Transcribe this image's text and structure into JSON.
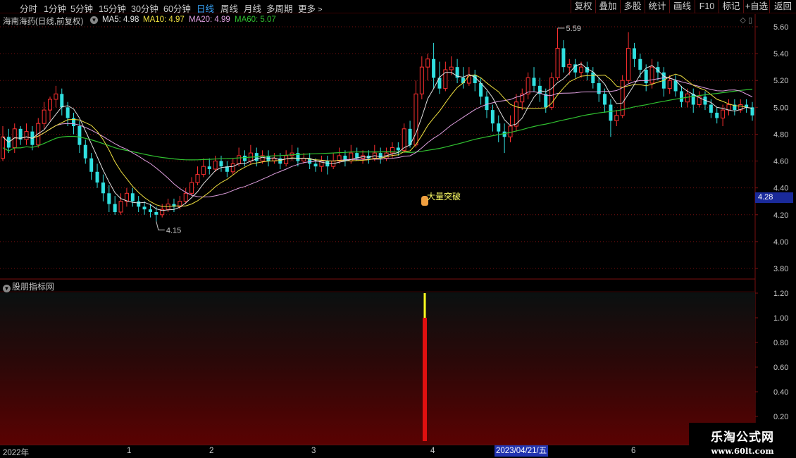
{
  "toolbar": {
    "periods": [
      "分时",
      "1分钟",
      "5分钟",
      "15分钟",
      "30分钟",
      "60分钟",
      "日线",
      "周线",
      "月线",
      "多周期",
      "更多"
    ],
    "active_period": "日线",
    "right_buttons": [
      "复权",
      "叠加",
      "多股",
      "统计",
      "画线",
      "F10",
      "标记",
      "+自选",
      "返回"
    ]
  },
  "info": {
    "stock_name": "海南海药(日线,前复权)",
    "ma_items": [
      {
        "label": "MA5: 4.98",
        "color": "#e0e0e0"
      },
      {
        "label": "MA10: 4.97",
        "color": "#f0e040"
      },
      {
        "label": "MA20: 4.99",
        "color": "#e0a0e0"
      },
      {
        "label": "MA60: 5.07",
        "color": "#30c030"
      }
    ],
    "top_icons": "◇ ▯"
  },
  "price_axis": {
    "labels": [
      "5.60",
      "5.40",
      "5.20",
      "5.00",
      "4.80",
      "4.60",
      "4.40",
      "4.20",
      "4.00",
      "3.80"
    ],
    "current_price_tag": "4.28"
  },
  "annotations": {
    "high_label": "5.59",
    "low_label": "4.15",
    "signal_text": "大量突破"
  },
  "indicator": {
    "title": "股朋指标网",
    "axis_labels": [
      "1.20",
      "1.00",
      "0.80",
      "0.60",
      "0.40",
      "0.20"
    ],
    "signal_value": 1.0
  },
  "date_axis": {
    "labels": [
      "2022年",
      "1",
      "2",
      "3",
      "4",
      "6"
    ],
    "cursor_date": "2023/04/21/五"
  },
  "watermark": {
    "title": "乐淘公式网",
    "url": "www.60lt.com"
  },
  "colors": {
    "up": "#ff3030",
    "down": "#30e0e0",
    "ma5": "#e0e0e0",
    "ma10": "#f0e040",
    "ma20": "#e0a0e0",
    "ma60": "#30c030",
    "grid": "#7a1010"
  },
  "chart_data": {
    "type": "candlestick",
    "ylim": [
      3.75,
      5.65
    ],
    "candles": [
      [
        4.62,
        4.78,
        4.86,
        4.6
      ],
      [
        4.78,
        4.7,
        4.84,
        4.66
      ],
      [
        4.7,
        4.84,
        4.88,
        4.66
      ],
      [
        4.84,
        4.76,
        4.86,
        4.72
      ],
      [
        4.76,
        4.82,
        4.88,
        4.72
      ],
      [
        4.82,
        4.72,
        4.86,
        4.68
      ],
      [
        4.72,
        4.88,
        4.92,
        4.7
      ],
      [
        4.88,
        4.98,
        5.04,
        4.84
      ],
      [
        4.98,
        5.06,
        5.08,
        4.9
      ],
      [
        5.06,
        5.1,
        5.16,
        5.0
      ],
      [
        5.1,
        5.0,
        5.14,
        4.94
      ],
      [
        5.0,
        4.92,
        5.04,
        4.86
      ],
      [
        4.92,
        4.86,
        4.96,
        4.8
      ],
      [
        4.86,
        4.72,
        4.9,
        4.66
      ],
      [
        4.72,
        4.62,
        4.76,
        4.58
      ],
      [
        4.62,
        4.52,
        4.66,
        4.46
      ],
      [
        4.52,
        4.44,
        4.58,
        4.4
      ],
      [
        4.44,
        4.36,
        4.5,
        4.3
      ],
      [
        4.36,
        4.28,
        4.42,
        4.22
      ],
      [
        4.28,
        4.22,
        4.34,
        4.2
      ],
      [
        4.22,
        4.3,
        4.36,
        4.2
      ],
      [
        4.3,
        4.36,
        4.4,
        4.26
      ],
      [
        4.36,
        4.3,
        4.4,
        4.26
      ],
      [
        4.3,
        4.26,
        4.34,
        4.22
      ],
      [
        4.26,
        4.24,
        4.3,
        4.2
      ],
      [
        4.24,
        4.22,
        4.28,
        4.18
      ],
      [
        4.22,
        4.2,
        4.26,
        4.15
      ],
      [
        4.2,
        4.24,
        4.28,
        4.18
      ],
      [
        4.24,
        4.28,
        4.32,
        4.22
      ],
      [
        4.28,
        4.26,
        4.32,
        4.22
      ],
      [
        4.26,
        4.3,
        4.34,
        4.24
      ],
      [
        4.3,
        4.36,
        4.4,
        4.28
      ],
      [
        4.36,
        4.44,
        4.48,
        4.34
      ],
      [
        4.44,
        4.5,
        4.56,
        4.42
      ],
      [
        4.5,
        4.56,
        4.62,
        4.48
      ],
      [
        4.56,
        4.54,
        4.62,
        4.5
      ],
      [
        4.54,
        4.6,
        4.64,
        4.52
      ],
      [
        4.6,
        4.56,
        4.64,
        4.52
      ],
      [
        4.56,
        4.52,
        4.6,
        4.48
      ],
      [
        4.52,
        4.58,
        4.62,
        4.5
      ],
      [
        4.58,
        4.64,
        4.7,
        4.56
      ],
      [
        4.64,
        4.6,
        4.68,
        4.56
      ],
      [
        4.6,
        4.66,
        4.72,
        4.58
      ],
      [
        4.66,
        4.6,
        4.7,
        4.56
      ],
      [
        4.6,
        4.64,
        4.68,
        4.58
      ],
      [
        4.64,
        4.6,
        4.68,
        4.56
      ],
      [
        4.6,
        4.62,
        4.66,
        4.58
      ],
      [
        4.62,
        4.58,
        4.66,
        4.54
      ],
      [
        4.58,
        4.64,
        4.68,
        4.56
      ],
      [
        4.64,
        4.66,
        4.72,
        4.6
      ],
      [
        4.66,
        4.6,
        4.7,
        4.56
      ],
      [
        4.6,
        4.62,
        4.66,
        4.58
      ],
      [
        4.62,
        4.58,
        4.66,
        4.54
      ],
      [
        4.58,
        4.56,
        4.62,
        4.52
      ],
      [
        4.56,
        4.6,
        4.64,
        4.52
      ],
      [
        4.6,
        4.56,
        4.64,
        4.5
      ],
      [
        4.56,
        4.6,
        4.66,
        4.54
      ],
      [
        4.6,
        4.64,
        4.7,
        4.58
      ],
      [
        4.64,
        4.6,
        4.68,
        4.56
      ],
      [
        4.6,
        4.66,
        4.72,
        4.58
      ],
      [
        4.66,
        4.62,
        4.7,
        4.6
      ],
      [
        4.62,
        4.64,
        4.68,
        4.58
      ],
      [
        4.64,
        4.62,
        4.68,
        4.58
      ],
      [
        4.62,
        4.66,
        4.72,
        4.6
      ],
      [
        4.66,
        4.62,
        4.7,
        4.58
      ],
      [
        4.62,
        4.66,
        4.7,
        4.6
      ],
      [
        4.66,
        4.7,
        4.74,
        4.62
      ],
      [
        4.7,
        4.68,
        4.74,
        4.64
      ],
      [
        4.68,
        4.84,
        4.88,
        4.66
      ],
      [
        4.84,
        4.72,
        4.9,
        4.7
      ],
      [
        4.72,
        5.1,
        5.2,
        4.7
      ],
      [
        5.1,
        5.3,
        5.38,
        5.06
      ],
      [
        5.3,
        5.36,
        5.4,
        5.2
      ],
      [
        5.36,
        5.22,
        5.48,
        5.14
      ],
      [
        5.22,
        5.14,
        5.34,
        5.1
      ],
      [
        5.14,
        5.28,
        5.34,
        5.12
      ],
      [
        5.28,
        5.3,
        5.38,
        5.24
      ],
      [
        5.3,
        5.22,
        5.36,
        5.18
      ],
      [
        5.22,
        5.18,
        5.3,
        5.14
      ],
      [
        5.18,
        5.24,
        5.3,
        5.16
      ],
      [
        5.24,
        5.18,
        5.28,
        5.12
      ],
      [
        5.18,
        5.08,
        5.22,
        5.02
      ],
      [
        5.08,
        4.98,
        5.12,
        4.92
      ],
      [
        4.98,
        4.88,
        5.02,
        4.82
      ],
      [
        4.88,
        4.82,
        4.94,
        4.74
      ],
      [
        4.82,
        4.78,
        4.88,
        4.66
      ],
      [
        4.78,
        4.86,
        4.94,
        4.74
      ],
      [
        4.86,
        5.04,
        5.1,
        4.82
      ],
      [
        5.04,
        5.1,
        5.14,
        4.98
      ],
      [
        5.1,
        5.22,
        5.26,
        5.06
      ],
      [
        5.22,
        5.16,
        5.3,
        5.12
      ],
      [
        5.16,
        5.1,
        5.22,
        5.04
      ],
      [
        5.1,
        5.0,
        5.14,
        4.96
      ],
      [
        5.0,
        5.22,
        5.26,
        4.98
      ],
      [
        5.22,
        5.44,
        5.59,
        5.2
      ],
      [
        5.44,
        5.3,
        5.5,
        5.26
      ],
      [
        5.3,
        5.32,
        5.36,
        5.24
      ],
      [
        5.32,
        5.26,
        5.36,
        5.22
      ],
      [
        5.26,
        5.3,
        5.34,
        5.22
      ],
      [
        5.3,
        5.26,
        5.34,
        5.2
      ],
      [
        5.26,
        5.18,
        5.3,
        5.14
      ],
      [
        5.18,
        5.1,
        5.22,
        5.04
      ],
      [
        5.1,
        5.02,
        5.14,
        4.96
      ],
      [
        5.02,
        4.9,
        5.06,
        4.78
      ],
      [
        4.9,
        4.94,
        4.98,
        4.86
      ],
      [
        4.94,
        5.2,
        5.24,
        4.92
      ],
      [
        5.2,
        5.44,
        5.56,
        5.18
      ],
      [
        5.44,
        5.36,
        5.48,
        5.3
      ],
      [
        5.36,
        5.28,
        5.4,
        5.22
      ],
      [
        5.28,
        5.18,
        5.32,
        5.12
      ],
      [
        5.18,
        5.3,
        5.36,
        5.14
      ],
      [
        5.3,
        5.26,
        5.34,
        5.2
      ],
      [
        5.26,
        5.14,
        5.3,
        5.08
      ],
      [
        5.14,
        5.2,
        5.24,
        5.1
      ],
      [
        5.2,
        5.12,
        5.24,
        5.08
      ],
      [
        5.12,
        5.04,
        5.16,
        5.0
      ],
      [
        5.04,
        5.1,
        5.14,
        5.0
      ],
      [
        5.1,
        5.02,
        5.14,
        4.96
      ],
      [
        5.02,
        5.08,
        5.12,
        5.0
      ],
      [
        5.08,
        5.02,
        5.12,
        4.98
      ],
      [
        5.02,
        4.96,
        5.06,
        4.92
      ],
      [
        4.96,
        4.92,
        5.0,
        4.88
      ],
      [
        4.92,
        4.98,
        5.02,
        4.86
      ],
      [
        4.98,
        5.02,
        5.06,
        4.94
      ],
      [
        5.02,
        4.98,
        5.06,
        4.94
      ],
      [
        4.98,
        5.02,
        5.06,
        4.96
      ],
      [
        5.02,
        5.0,
        5.06,
        4.96
      ],
      [
        5.0,
        4.94,
        5.04,
        4.9
      ]
    ]
  }
}
